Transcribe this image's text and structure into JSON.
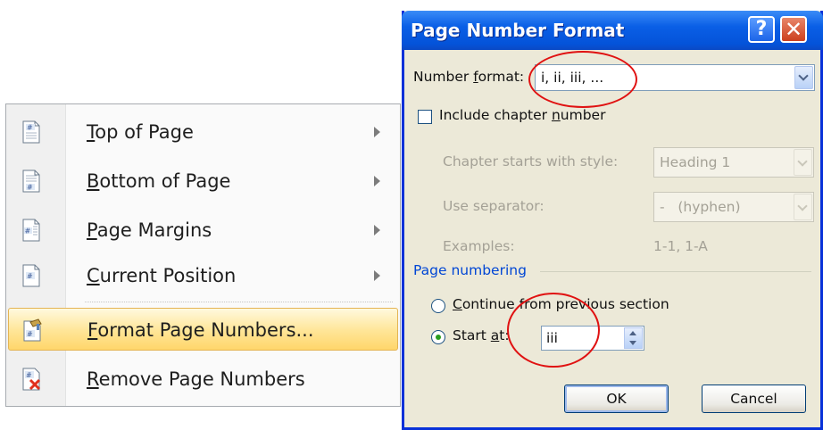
{
  "menu": {
    "items": [
      {
        "label_u": "T",
        "label_rest": "op of Page",
        "icon": "page-top-number-icon",
        "has_submenu": true,
        "highlighted": false
      },
      {
        "label_u": "B",
        "label_rest": "ottom of Page",
        "icon": "page-bottom-number-icon",
        "has_submenu": true,
        "highlighted": false
      },
      {
        "label_u": "P",
        "label_rest": "age Margins",
        "icon": "page-margins-number-icon",
        "has_submenu": true,
        "highlighted": false
      },
      {
        "label_u": "C",
        "label_rest": "urrent Position",
        "icon": "current-position-number-icon",
        "has_submenu": true,
        "highlighted": false
      },
      {
        "label_u": "F",
        "label_rest": "ormat Page Numbers...",
        "icon": "format-page-numbers-icon",
        "has_submenu": false,
        "highlighted": true
      },
      {
        "label_u": "R",
        "label_rest": "emove Page Numbers",
        "icon": "remove-page-numbers-icon",
        "has_submenu": false,
        "highlighted": false
      }
    ]
  },
  "dialog": {
    "title": "Page Number Format",
    "help_glyph": "?",
    "close_glyph": "✕",
    "number_format": {
      "label_a": "Number ",
      "label_u": "f",
      "label_b": "ormat:",
      "value": "i, ii, iii, ..."
    },
    "include_chapter": {
      "label_a": "Include chapter ",
      "label_u": "n",
      "label_b": "umber",
      "checked": false
    },
    "chapter_style": {
      "label": "Chapter starts with style:",
      "value": "Heading 1"
    },
    "separator": {
      "label": "Use separator:",
      "value": "-   (hyphen)"
    },
    "examples": {
      "label": "Examples:",
      "value": "1-1, 1-A"
    },
    "page_numbering": {
      "title": "Page numbering",
      "continue": {
        "label_u": "C",
        "label_b": "ontinue from previous section",
        "selected": false
      },
      "start_at": {
        "label_a": "Start ",
        "label_u": "a",
        "label_b": "t:",
        "value": "iii",
        "selected": true
      }
    },
    "ok_label": "OK",
    "cancel_label": "Cancel"
  },
  "colors": {
    "annotation": "#e01212",
    "highlight": "#ffe596",
    "titlebar": "#0453d9"
  }
}
